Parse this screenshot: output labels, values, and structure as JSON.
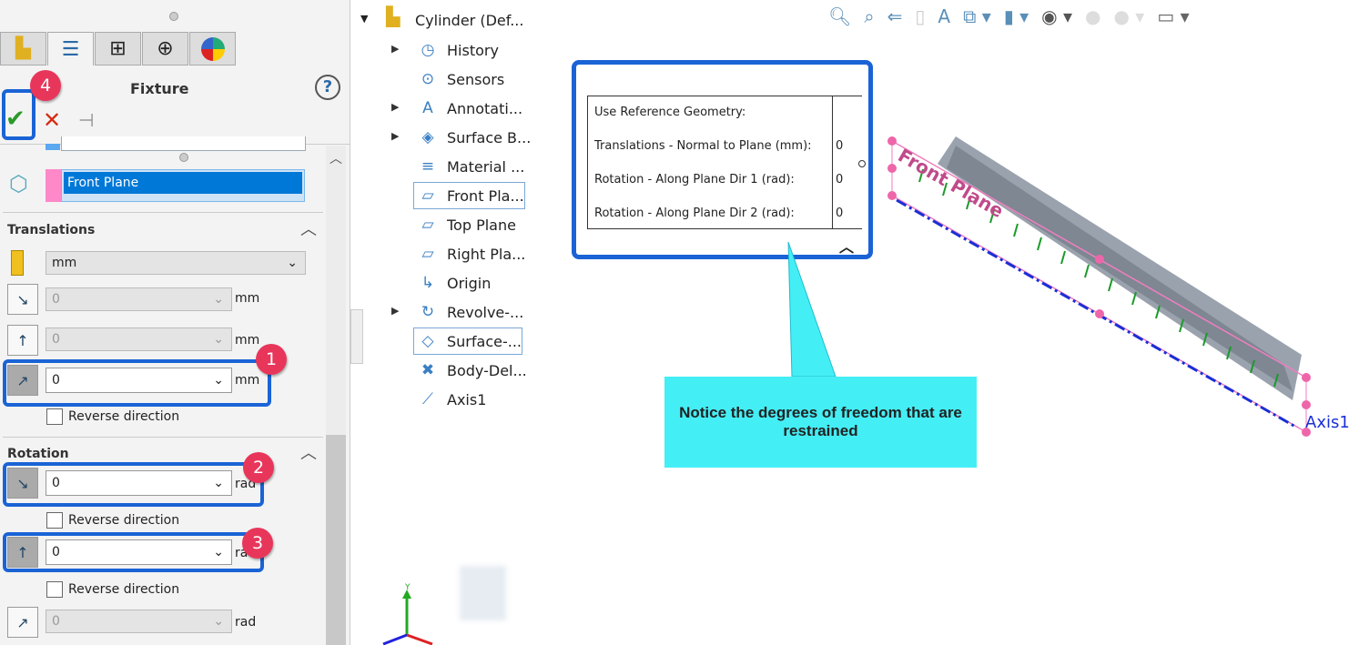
{
  "panel": {
    "title": "Fixture",
    "tabs": [
      "part-icon",
      "property-manager-icon",
      "configuration-icon",
      "target-icon",
      "appearance-icon"
    ],
    "selection": "Front Plane",
    "translations": {
      "header": "Translations",
      "unit": "mm",
      "rows": [
        {
          "value": "0",
          "unit": "mm",
          "enabled": false
        },
        {
          "value": "0",
          "unit": "mm",
          "enabled": false
        },
        {
          "value": "0",
          "unit": "mm",
          "enabled": true
        }
      ],
      "reverse": "Reverse direction"
    },
    "rotation": {
      "header": "Rotation",
      "rows": [
        {
          "value": "0",
          "unit": "rad",
          "enabled": true
        },
        {
          "value": "0",
          "unit": "rad",
          "enabled": true
        },
        {
          "value": "0",
          "unit": "rad",
          "enabled": false
        }
      ],
      "reverse": "Reverse direction"
    },
    "badges": [
      "1",
      "2",
      "3",
      "4"
    ]
  },
  "tree": {
    "root": "Cylinder  (Def...",
    "items": [
      "History",
      "Sensors",
      "Annotati...",
      "Surface B...",
      "Material ...",
      "Front Pla...",
      "Top Plane",
      "Right Pla...",
      "Origin",
      "Revolve-...",
      "Surface-...",
      "Body-Del...",
      "Axis1"
    ]
  },
  "tooltip": {
    "rows": [
      {
        "label": "Use Reference Geometry:",
        "value": ""
      },
      {
        "label": "Translations - Normal to Plane (mm):",
        "value": "0"
      },
      {
        "label": "Rotation - Along Plane Dir 1 (rad):",
        "value": "0"
      },
      {
        "label": "Rotation - Along Plane Dir 2 (rad):",
        "value": "0"
      }
    ]
  },
  "callout": "Notice the degrees of freedom that are restrained",
  "model": {
    "plane_label": "Front Plane",
    "axis_label": "Axis1",
    "triad_label": "Y"
  },
  "colors": {
    "highlight": "#1a63d6",
    "badge": "#e8365b",
    "callout": "#44eef5",
    "selection": "#0078d7"
  }
}
